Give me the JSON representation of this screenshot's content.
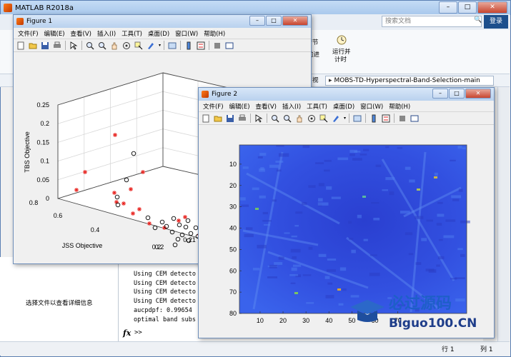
{
  "main_window": {
    "title": "MATLAB R2018a",
    "search_placeholder": "搜索文档",
    "login_label": "登录",
    "ribbon": {
      "run_section_label": "运行节",
      "advance_label": "前进",
      "run_time_label_1": "运行并",
      "run_time_label_2": "计时"
    },
    "address_path": "MOBS-TD-Hyperspectral-Band-Selection-main",
    "address_prefix": "视",
    "details_message": "选择文件以查看详细信息",
    "command_lines": [
      "Using CEM detecto",
      "Using CEM detecto",
      "Using CEM detecto",
      "Using CEM detecto",
      "aucpdpf: 0.99654",
      "optimal band subs"
    ],
    "prompt": ">>",
    "fx": "fx",
    "status_row_label": "行",
    "status_row_value": "1",
    "status_col_label": "列",
    "status_col_value": "1"
  },
  "menu_items": [
    "文件(F)",
    "编辑(E)",
    "查看(V)",
    "插入(I)",
    "工具(T)",
    "桌面(D)",
    "窗口(W)",
    "帮助(H)"
  ],
  "figure1": {
    "title": "Figure 1",
    "chart_data": {
      "type": "scatter",
      "projection": "3d",
      "zlabel": "TBS Objective",
      "xlabel": "JSS Objective",
      "z_ticks": [
        "0",
        "0.05",
        "0.1",
        "0.15",
        "0.2",
        "0.25"
      ],
      "x_ticks": [
        "0.2",
        "0.4",
        "0.6",
        "0.8"
      ],
      "y_ticks": [
        "0.2",
        "0.21"
      ],
      "zlim": [
        0,
        0.25
      ],
      "grid": true,
      "series": [
        {
          "marker": "star",
          "color": "#e8211d"
        },
        {
          "marker": "circle",
          "color": "#000000"
        }
      ]
    }
  },
  "figure2": {
    "title": "Figure 2",
    "chart_data": {
      "type": "heatmap",
      "colormap": "parula",
      "y_ticks": [
        "10",
        "20",
        "30",
        "40",
        "50",
        "60",
        "70",
        "80"
      ],
      "x_ticks": [
        "10",
        "20",
        "30",
        "40",
        "50",
        "60",
        "70"
      ],
      "xlim": [
        1,
        100
      ],
      "ylim": [
        1,
        80
      ]
    }
  },
  "watermark": {
    "site": "Biguo100.CN",
    "cn": "必过源码"
  }
}
